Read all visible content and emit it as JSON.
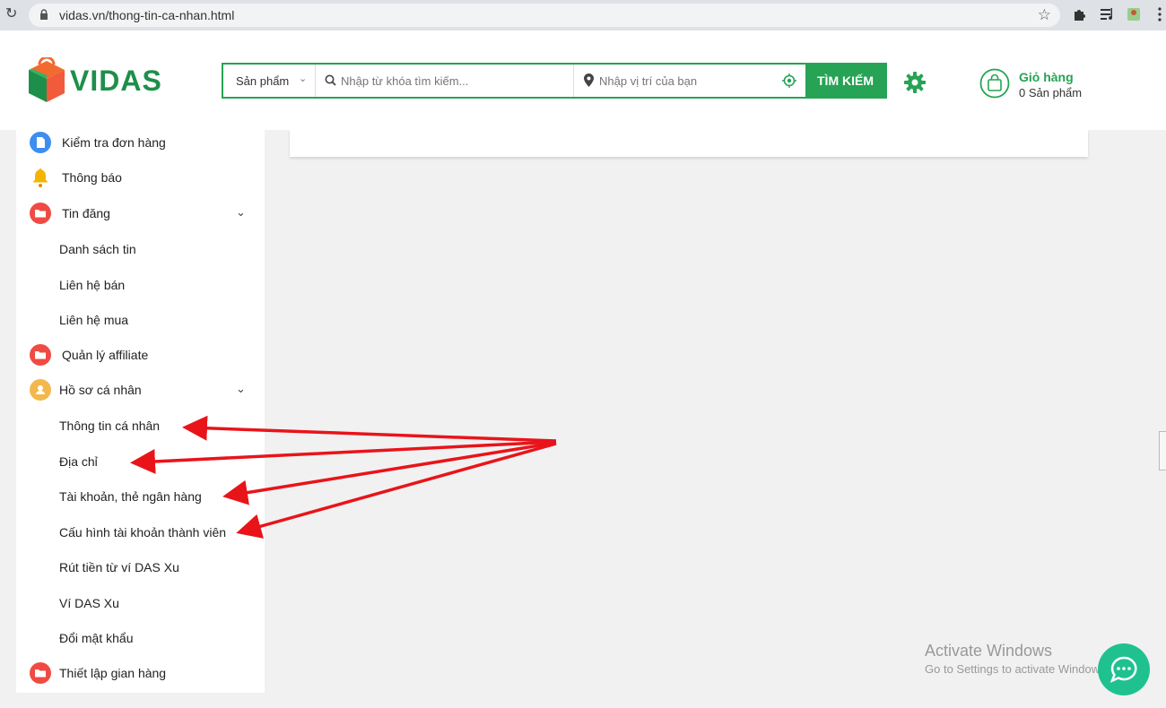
{
  "browser": {
    "url": "vidas.vn/thong-tin-ca-nhan.html"
  },
  "header": {
    "logo_text": "VIDAS",
    "category_label": "Sản phẩm",
    "keyword_placeholder": "Nhập từ khóa tìm kiếm...",
    "location_placeholder": "Nhập vị trí của bạn",
    "search_button": "TÌM KIẾM",
    "cart_title": "Giỏ hàng",
    "cart_count": "0 Sản phẩm"
  },
  "sidebar": {
    "items": [
      {
        "label": "Kiểm tra đơn hàng",
        "icon": "document-icon",
        "color": "#3d8ef0"
      },
      {
        "label": "Thông báo",
        "icon": "bell-icon",
        "color": "#f4b400"
      },
      {
        "label": "Tin đăng",
        "icon": "folder-icon",
        "color": "#ef4b44"
      },
      {
        "label": "Quản lý affiliate",
        "icon": "folder-icon",
        "color": "#ef4b44"
      },
      {
        "label": "Hồ sơ cá nhân",
        "icon": "user-icon",
        "color": "#f2b84b"
      },
      {
        "label": "Thiết lập gian hàng",
        "icon": "folder-icon",
        "color": "#ef4b44"
      }
    ],
    "tin_dang_sub": [
      "Danh sách tin",
      "Liên hệ bán",
      "Liên hệ mua"
    ],
    "ho_so_sub": [
      "Thông tin cá nhân",
      "Địa chỉ",
      "Tài khoản, thẻ ngân hàng",
      "Cấu hình tài khoản thành viên",
      "Rút tiền từ ví DAS Xu",
      "Ví DAS Xu",
      "Đổi mật khẩu"
    ]
  },
  "overlay": {
    "activate_title": "Activate Windows",
    "activate_sub": "Go to Settings to activate Windows."
  },
  "colors": {
    "brand_green": "#26a354",
    "arrow_red": "#e8141a"
  }
}
